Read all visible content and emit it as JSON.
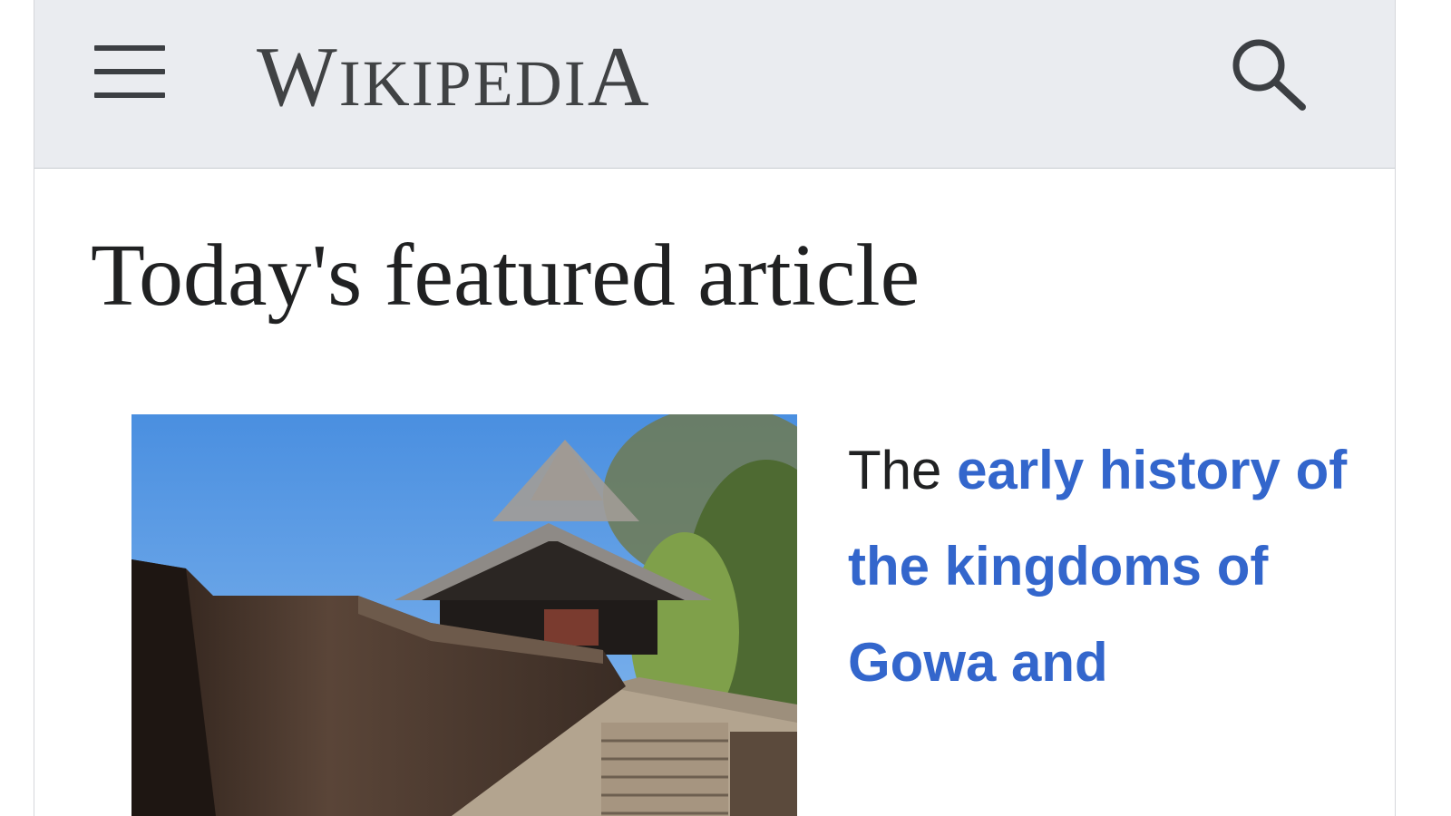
{
  "header": {
    "menu_icon": "hamburger-menu-icon",
    "wordmark": {
      "w": "W",
      "ikipedi": "IKIPEDI",
      "a": "A"
    },
    "search_icon": "search-icon",
    "background": "#eaecf0"
  },
  "featured": {
    "title": "Today's featured article",
    "image_alt": "Photograph of a fortress wall with stone stairs and a pointed roof under a blue sky",
    "extract_lead": "The ",
    "extract_link": "early history of the kingdoms of Gowa and"
  },
  "colors": {
    "link": "#3366cc",
    "text": "#202122",
    "header_bg": "#eaecf0"
  }
}
